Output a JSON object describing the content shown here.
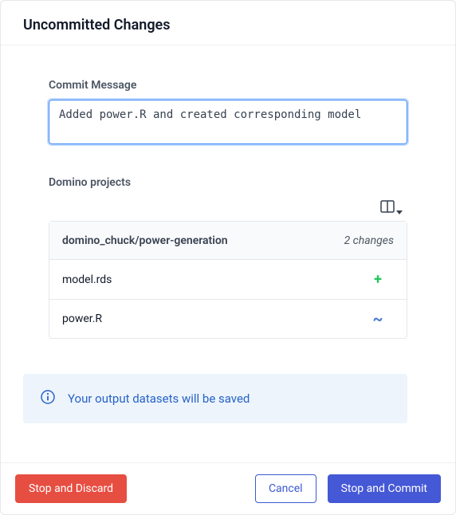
{
  "header": {
    "title": "Uncommitted Changes"
  },
  "commit": {
    "label": "Commit Message",
    "value": "Added power.R and created corresponding model"
  },
  "projects": {
    "label": "Domino projects",
    "columns_button": "columns",
    "repo_name": "domino_chuck/power-generation",
    "changes_count_text": "2 changes",
    "files": [
      {
        "name": "model.rds",
        "status_glyph": "+",
        "status_name": "added"
      },
      {
        "name": "power.R",
        "status_glyph": "~",
        "status_name": "modified"
      }
    ]
  },
  "banner": {
    "icon": "info",
    "text": "Your output datasets will be saved"
  },
  "footer": {
    "discard_label": "Stop and Discard",
    "cancel_label": "Cancel",
    "commit_label": "Stop and Commit"
  }
}
